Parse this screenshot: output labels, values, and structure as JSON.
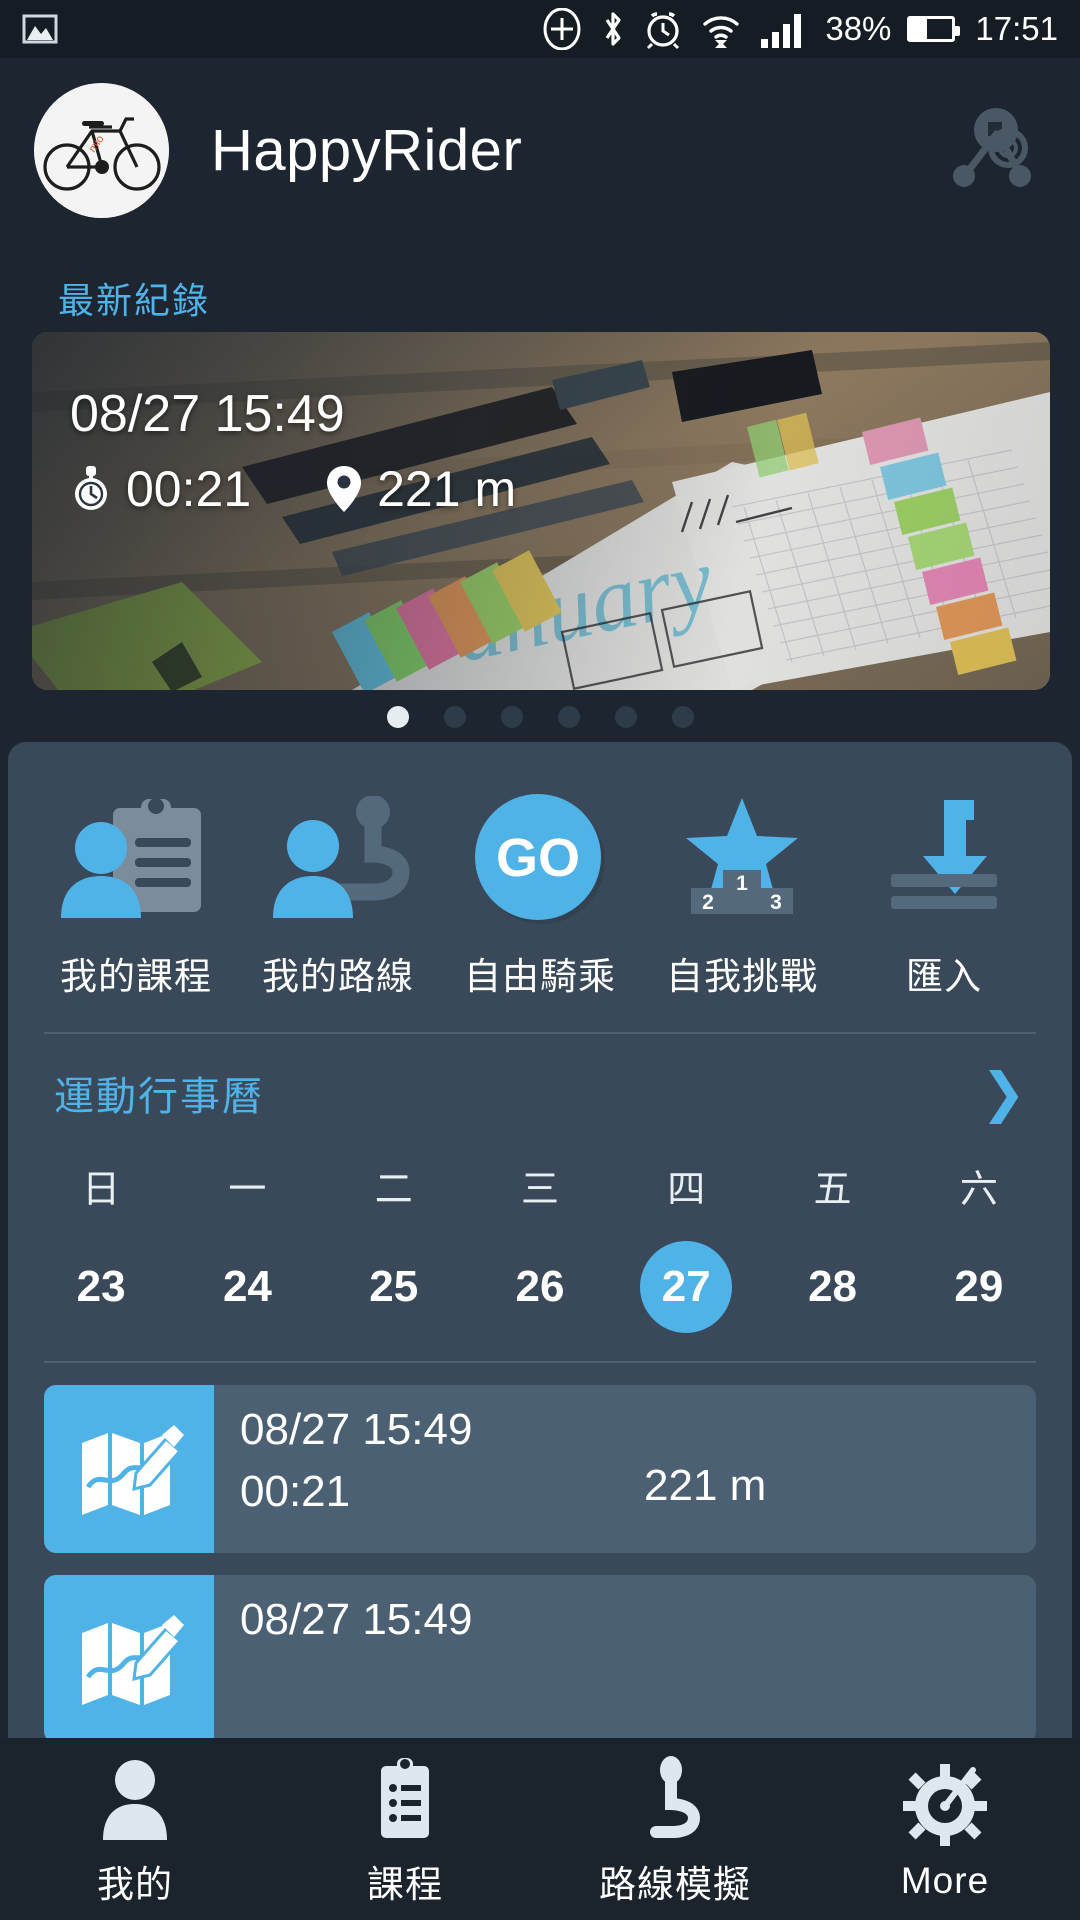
{
  "status_bar": {
    "left_icons": [
      "image-icon"
    ],
    "right_icons": [
      "add-circle-icon",
      "bluetooth-icon",
      "alarm-icon",
      "wifi-icon",
      "signal-icon"
    ],
    "battery_percent": "38%",
    "time": "17:51"
  },
  "header": {
    "title": "HappyRider",
    "avatar": "bicycle-avatar",
    "action_icon": "route-sync-icon"
  },
  "latest": {
    "section_label": "最新紀錄",
    "date": "08/27 15:49",
    "duration": "00:21",
    "distance": "221 m",
    "duration_icon": "stopwatch-icon",
    "distance_icon": "map-pin-icon",
    "carousel": {
      "count": 6,
      "active_index": 0
    }
  },
  "quick_actions": [
    {
      "label": "我的課程",
      "icon": "person-clipboard-icon"
    },
    {
      "label": "我的路線",
      "icon": "person-route-icon"
    },
    {
      "label": "自由騎乘",
      "icon": "go-button-icon",
      "text": "GO"
    },
    {
      "label": "自我挑戰",
      "icon": "podium-star-icon",
      "podium": [
        "1",
        "2",
        "3"
      ]
    },
    {
      "label": "匯入",
      "icon": "import-arrow-icon"
    }
  ],
  "calendar": {
    "title": "運動行事曆",
    "more_icon": "chevron-right-icon",
    "weekdays": [
      "日",
      "一",
      "二",
      "三",
      "四",
      "五",
      "六"
    ],
    "days": [
      "23",
      "24",
      "25",
      "26",
      "27",
      "28",
      "29"
    ],
    "selected_day": "27"
  },
  "records": [
    {
      "date": "08/27 15:49",
      "duration": "00:21",
      "distance": "221 m",
      "icon": "map-edit-icon"
    },
    {
      "date": "08/27 15:49",
      "duration": "",
      "distance": "",
      "icon": "map-edit-icon"
    }
  ],
  "bottom_nav": [
    {
      "label": "我的",
      "icon": "person-icon",
      "active": true
    },
    {
      "label": "課程",
      "icon": "clipboard-icon",
      "active": false
    },
    {
      "label": "路線模擬",
      "icon": "route-icon",
      "active": false
    },
    {
      "label": "More",
      "icon": "gear-speed-icon",
      "active": false
    }
  ],
  "colors": {
    "background": "#1d2630",
    "panel": "#39495a",
    "accent": "#4fb3e8",
    "row": "#4c6073",
    "statusbar": "#151c24",
    "navbar": "#1b232c"
  }
}
